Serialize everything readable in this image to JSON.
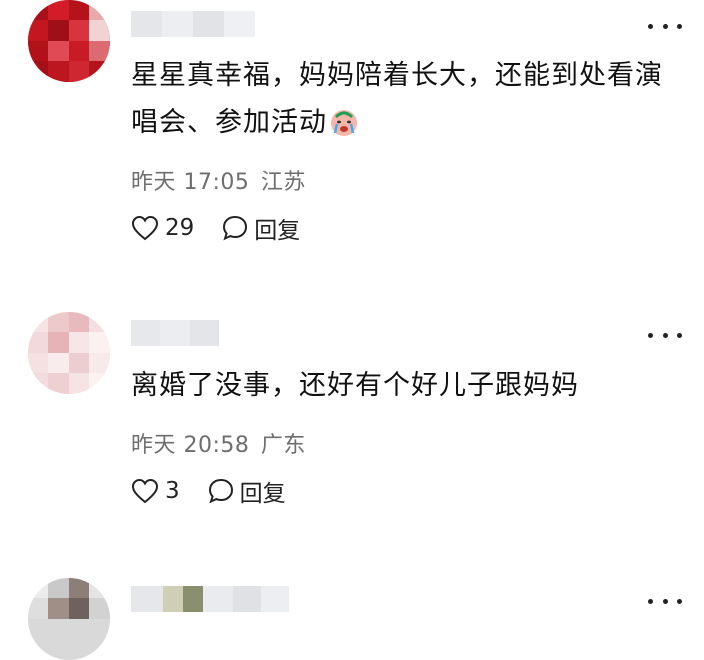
{
  "comments": [
    {
      "text": "星星真幸福，妈妈陪着长大，还能到处看演唱会、参加活动",
      "emoji": "crying-face-emoji",
      "date": "昨天 17:05",
      "location": "江苏",
      "likes": "29",
      "reply_label": "回复"
    },
    {
      "text": "离婚了没事，还好有个好儿子跟妈妈",
      "date": "昨天 20:58",
      "location": "广东",
      "likes": "3",
      "reply_label": "回复"
    },
    {}
  ],
  "icons": {
    "like": "heart-outline-icon",
    "reply": "speech-bubble-icon",
    "more": "more-dots-icon"
  },
  "colors": {
    "meta_text": "#6e6e6e",
    "avatar1_primary": "#c0141e",
    "avatar2_primary": "#f0d6d8"
  }
}
